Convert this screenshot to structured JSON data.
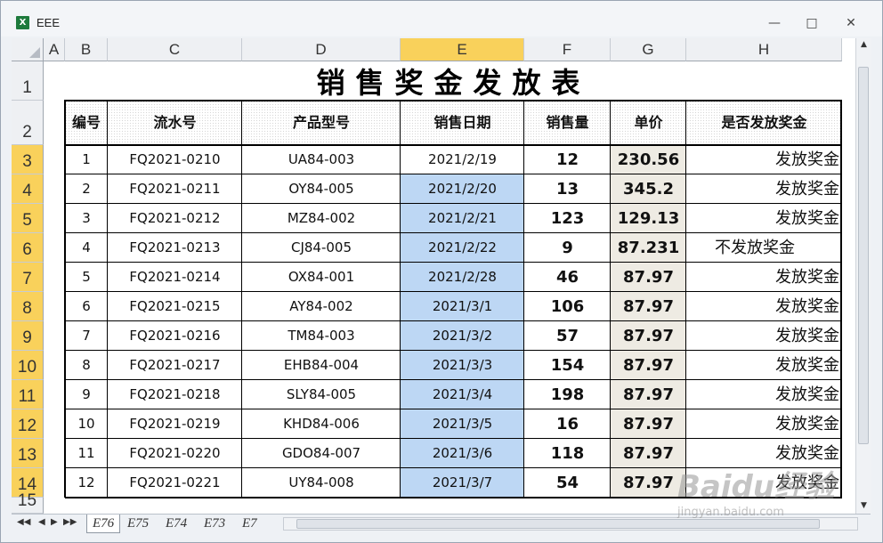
{
  "window": {
    "title": "EEE",
    "minimize": "—",
    "maximize": "□",
    "close": "✕"
  },
  "columns": [
    "A",
    "B",
    "C",
    "D",
    "E",
    "F",
    "G",
    "H"
  ],
  "selected_column": "E",
  "rows": [
    "1",
    "2",
    "3",
    "4",
    "5",
    "6",
    "7",
    "8",
    "9",
    "10",
    "11",
    "12",
    "13",
    "14",
    "15"
  ],
  "sheet_title": "销售奖金发放表",
  "headers": [
    "编号",
    "流水号",
    "产品型号",
    "销售日期",
    "销售量",
    "单价",
    "是否发放奖金"
  ],
  "table": [
    [
      "1",
      "FQ2021-0210",
      "UA84-003",
      "2021/2/19",
      "12",
      "230.56",
      "发放奖金"
    ],
    [
      "2",
      "FQ2021-0211",
      "OY84-005",
      "2021/2/20",
      "13",
      "345.2",
      "发放奖金"
    ],
    [
      "3",
      "FQ2021-0212",
      "MZ84-002",
      "2021/2/21",
      "123",
      "129.13",
      "发放奖金"
    ],
    [
      "4",
      "FQ2021-0213",
      "CJ84-005",
      "2021/2/22",
      "9",
      "87.231",
      "不发放奖金"
    ],
    [
      "5",
      "FQ2021-0214",
      "OX84-001",
      "2021/2/28",
      "46",
      "87.97",
      "发放奖金"
    ],
    [
      "6",
      "FQ2021-0215",
      "AY84-002",
      "2021/3/1",
      "106",
      "87.97",
      "发放奖金"
    ],
    [
      "7",
      "FQ2021-0216",
      "TM84-003",
      "2021/3/2",
      "57",
      "87.97",
      "发放奖金"
    ],
    [
      "8",
      "FQ2021-0217",
      "EHB84-004",
      "2021/3/3",
      "154",
      "87.97",
      "发放奖金"
    ],
    [
      "9",
      "FQ2021-0218",
      "SLY84-005",
      "2021/3/4",
      "198",
      "87.97",
      "发放奖金"
    ],
    [
      "10",
      "FQ2021-0219",
      "KHD84-006",
      "2021/3/5",
      "16",
      "87.97",
      "发放奖金"
    ],
    [
      "11",
      "FQ2021-0220",
      "GDO84-007",
      "2021/3/6",
      "118",
      "87.97",
      "发放奖金"
    ],
    [
      "12",
      "FQ2021-0221",
      "UY84-008",
      "2021/3/7",
      "54",
      "87.97",
      "发放奖金"
    ]
  ],
  "tabs": [
    "E76",
    "E75",
    "E74",
    "E73",
    "E7"
  ],
  "active_tab": "E76",
  "watermark": {
    "main": "Baidu经验",
    "sub": "jingyan.baidu.com"
  }
}
